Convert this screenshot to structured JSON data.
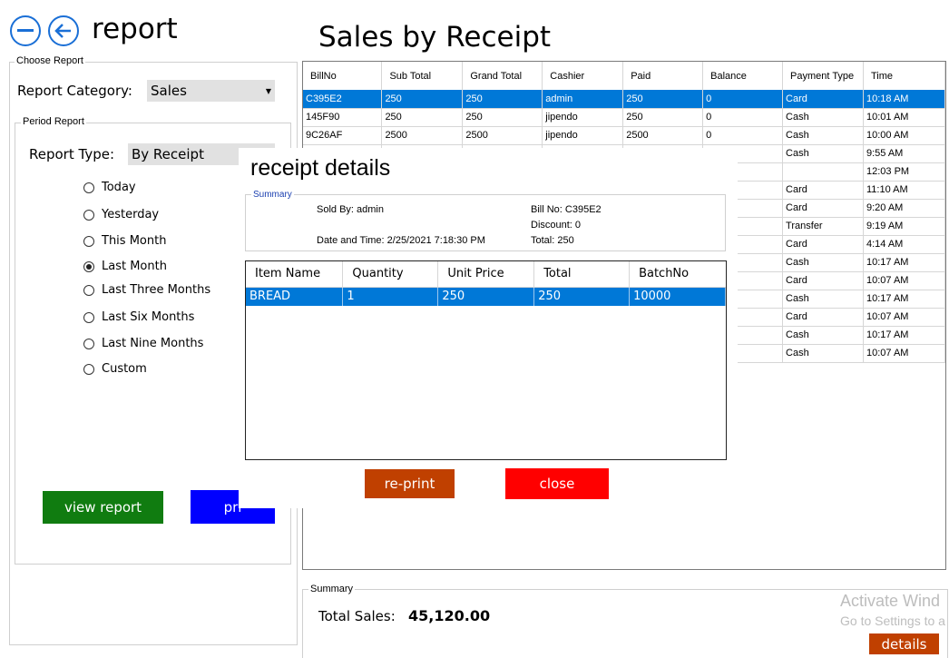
{
  "header": {
    "title": "report",
    "page_heading": "Sales by Receipt"
  },
  "colors": {
    "accent": "#1a6fd6",
    "selection": "#0078d7",
    "view_btn": "#107c10",
    "print_btn": "#0000ff",
    "reprint_btn": "#c04000",
    "close_btn": "#ff0000"
  },
  "choose_report": {
    "legend": "Choose Report",
    "category_label": "Report Category:",
    "category_value": "Sales",
    "period": {
      "legend": "Period Report",
      "type_label": "Report Type:",
      "type_value": "By Receipt",
      "options": [
        {
          "label": "Today",
          "checked": false
        },
        {
          "label": "Yesterday",
          "checked": false
        },
        {
          "label": "This Month",
          "checked": false
        },
        {
          "label": "Last Month",
          "checked": true
        },
        {
          "label": "Last Three Months",
          "checked": false
        },
        {
          "label": "Last Six Months",
          "checked": false
        },
        {
          "label": "Last Nine Months",
          "checked": false
        },
        {
          "label": "Custom",
          "checked": false
        }
      ],
      "view_label": "view report",
      "print_label": "pri"
    }
  },
  "grid": {
    "columns": [
      "BillNo",
      "Sub Total",
      "Grand Total",
      "Cashier",
      "Paid",
      "Balance",
      "Payment Type",
      "Time"
    ],
    "rows": [
      [
        "C395E2",
        "250",
        "250",
        "admin",
        "250",
        "0",
        "Card",
        "10:18 AM"
      ],
      [
        "145F90",
        "250",
        "250",
        "jipendo",
        "250",
        "0",
        "Cash",
        "10:01 AM"
      ],
      [
        "9C26AF",
        "2500",
        "2500",
        "jipendo",
        "2500",
        "0",
        "Cash",
        "10:00 AM"
      ],
      [
        "",
        "",
        "",
        "",
        "",
        "",
        "Cash",
        "9:55 AM"
      ],
      [
        "",
        "",
        "",
        "",
        "",
        "",
        "",
        "12:03 PM"
      ],
      [
        "",
        "",
        "",
        "",
        "",
        "",
        "Card",
        "11:10 AM"
      ],
      [
        "",
        "",
        "",
        "",
        "",
        "",
        "Card",
        "9:20 AM"
      ],
      [
        "",
        "",
        "",
        "",
        "",
        "",
        "Transfer",
        "9:19 AM"
      ],
      [
        "",
        "",
        "",
        "",
        "",
        "",
        "Card",
        "4:14 AM"
      ],
      [
        "",
        "",
        "",
        "",
        "",
        "",
        "Cash",
        "10:17 AM"
      ],
      [
        "",
        "",
        "",
        "",
        "",
        "",
        "Card",
        "10:07 AM"
      ],
      [
        "",
        "",
        "",
        "",
        "",
        "",
        "Cash",
        "10:17 AM"
      ],
      [
        "",
        "",
        "",
        "",
        "",
        "",
        "Card",
        "10:07 AM"
      ],
      [
        "",
        "",
        "",
        "",
        "",
        "",
        "Cash",
        "10:17 AM"
      ],
      [
        "",
        "",
        "",
        "",
        "",
        "",
        "Cash",
        "10:07 AM"
      ]
    ],
    "selected_index": 0
  },
  "summary": {
    "legend": "Summary",
    "total_label": "Total Sales:",
    "total_value": "45,120.00",
    "details_label": "details"
  },
  "watermark": {
    "line1": "Activate Wind",
    "line2": "Go to Settings to a"
  },
  "dialog": {
    "title": "receipt details",
    "summary_legend": "Summary",
    "sold_by": "Sold By: admin",
    "date_time": "Date and Time: 2/25/2021 7:18:30 PM",
    "bill_no": "Bill No: C395E2",
    "discount": "Discount: 0",
    "total": "Total: 250",
    "columns": [
      "Item Name",
      "Quantity",
      "Unit Price",
      "Total",
      "BatchNo"
    ],
    "rows": [
      [
        "BREAD",
        "1",
        "250",
        "250",
        "10000"
      ]
    ],
    "reprint_label": "re-print",
    "close_label": "close"
  }
}
